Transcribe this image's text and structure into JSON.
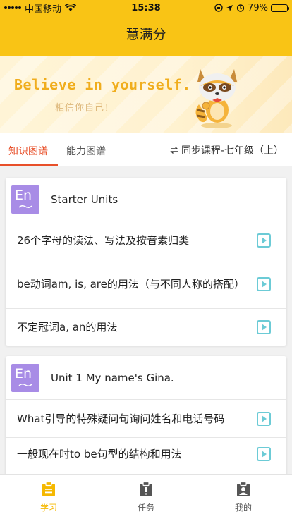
{
  "status": {
    "carrier": "中国移动",
    "time": "15:38",
    "battery": "79%",
    "battery_level": 0.79
  },
  "header": {
    "title": "慧满分"
  },
  "banner": {
    "slogan": "Believe in yourself.",
    "subtitle": "相信你自己！"
  },
  "tabs": {
    "items": [
      {
        "label": "知识图谱",
        "active": true
      },
      {
        "label": "能力图谱",
        "active": false
      }
    ],
    "sync_label": "同步课程-七年级（上）"
  },
  "units": [
    {
      "icon_text": "En",
      "title": "Starter Units",
      "items": [
        {
          "label": "26个字母的读法、写法及按音素归类"
        },
        {
          "label": "be动词am, is, are的用法（与不同人称的搭配）"
        },
        {
          "label": "不定冠词a, an的用法"
        }
      ]
    },
    {
      "icon_text": "En",
      "title": "Unit 1 My name's Gina.",
      "items": [
        {
          "label": "What引导的特殊疑问句询问姓名和电话号码"
        },
        {
          "label": "一般现在时to be句型的结构和用法"
        }
      ]
    }
  ],
  "bottom_nav": [
    {
      "label": "学习",
      "icon": "clipboard-icon",
      "active": true
    },
    {
      "label": "任务",
      "icon": "task-alert-icon",
      "active": false
    },
    {
      "label": "我的",
      "icon": "profile-icon",
      "active": false
    }
  ],
  "colors": {
    "header_bg": "#f9c415",
    "tab_active": "#e8502a",
    "unit_icon_bg": "#a88ce6",
    "play_icon": "#6ccbd6",
    "nav_active": "#f5b800"
  }
}
